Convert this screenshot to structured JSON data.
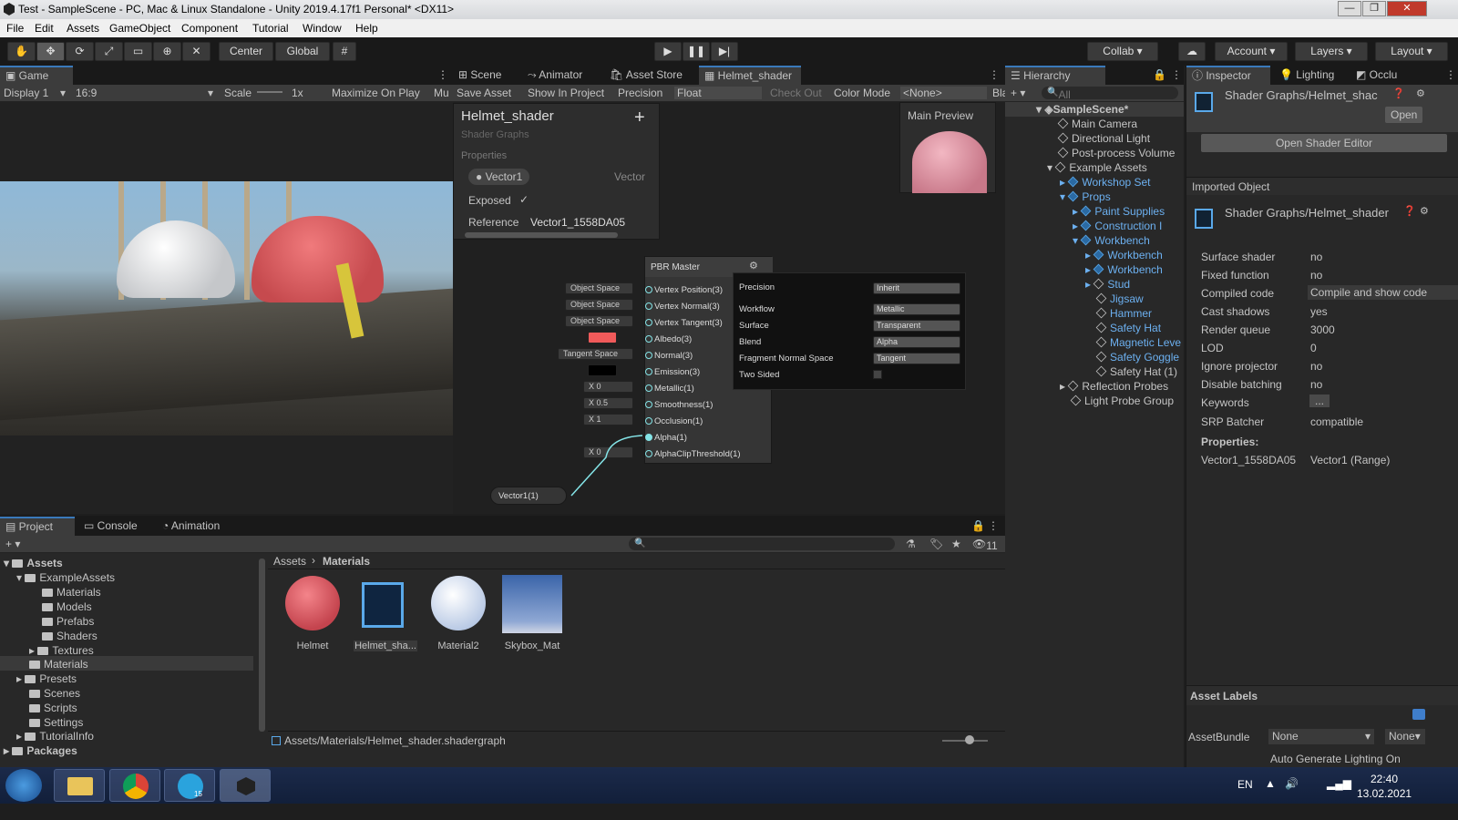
{
  "window": {
    "title": "Test - SampleScene - PC, Mac & Linux Standalone - Unity 2019.4.17f1 Personal* <DX11>"
  },
  "menu": [
    "File",
    "Edit",
    "Assets",
    "GameObject",
    "Component",
    "Tutorial",
    "Window",
    "Help"
  ],
  "toolbar": {
    "center": "Center",
    "global": "Global",
    "collab": "Collab",
    "account": "Account",
    "layers": "Layers",
    "layout": "Layout"
  },
  "game": {
    "tab": "Game",
    "display": "Display 1",
    "aspect": "16:9",
    "scale_label": "Scale",
    "scale_value": "1x",
    "maximize": "Maximize On Play",
    "mute": "Mu"
  },
  "center_tabs": [
    "Scene",
    "Animator",
    "Asset Store",
    "Helmet_shader"
  ],
  "sg_toolbar": {
    "save": "Save Asset",
    "show": "Show In Project",
    "precision_label": "Precision",
    "precision": "Float",
    "checkout": "Check Out",
    "colormode_label": "Color Mode",
    "colormode": "<None>",
    "bl": "Bla"
  },
  "blackboard": {
    "title": "Helmet_shader",
    "subtitle": "Shader Graphs",
    "section": "Properties",
    "prop_name": "Vector1",
    "prop_type": "Vector",
    "exposed_label": "Exposed",
    "reference_label": "Reference",
    "reference_value": "Vector1_1558DA05"
  },
  "main_preview": {
    "title": "Main Preview"
  },
  "pbr": {
    "title": "PBR Master",
    "inputs": [
      {
        "chip": "Object Space",
        "label": "Vertex Position(3)"
      },
      {
        "chip": "Object Space",
        "label": "Vertex Normal(3)"
      },
      {
        "chip": "Object Space",
        "label": "Vertex Tangent(3)"
      },
      {
        "chip": "",
        "label": "Albedo(3)"
      },
      {
        "chip": "Tangent Space",
        "label": "Normal(3)"
      },
      {
        "chip": "",
        "label": "Emission(3)"
      },
      {
        "chip": "X  0",
        "label": "Metallic(1)"
      },
      {
        "chip": "X  0.5",
        "label": "Smoothness(1)"
      },
      {
        "chip": "X  1",
        "label": "Occlusion(1)"
      },
      {
        "chip": "",
        "label": "Alpha(1)"
      },
      {
        "chip": "X  0",
        "label": "AlphaClipThreshold(1)"
      }
    ],
    "settings": [
      {
        "label": "Precision",
        "value": "Inherit"
      },
      {
        "label": "Workflow",
        "value": "Metallic"
      },
      {
        "label": "Surface",
        "value": "Transparent"
      },
      {
        "label": "Blend",
        "value": "Alpha"
      },
      {
        "label": "Fragment Normal Space",
        "value": "Tangent"
      },
      {
        "label": "Two Sided",
        "value": ""
      }
    ],
    "vector_node": "Vector1(1)"
  },
  "hierarchy": {
    "tab": "Hierarchy",
    "search": "All",
    "items": [
      "SampleScene*",
      "Main Camera",
      "Directional Light",
      "Post-process Volume",
      "Example Assets",
      "Workshop Set",
      "Props",
      "Paint Supplies",
      "Construction I",
      "Workbench",
      "Workbench",
      "Workbench",
      "Stud",
      "Jigsaw",
      "Hammer",
      "Safety Hat",
      "Magnetic Leve",
      "Safety Goggle",
      "Safety Hat (1)",
      "Reflection Probes",
      "Light Probe Group"
    ]
  },
  "inspector": {
    "tabs": [
      "Inspector",
      "Lighting",
      "Occlu"
    ],
    "header": "Shader Graphs/Helmet_shac",
    "open": "Open",
    "open_editor": "Open Shader Editor",
    "imported": "Imported Object",
    "imported_title": "Shader Graphs/Helmet_shader",
    "rows": [
      {
        "k": "Surface shader",
        "v": "no"
      },
      {
        "k": "Fixed function",
        "v": "no"
      },
      {
        "k": "Compiled code",
        "v": "Compile and show code"
      },
      {
        "k": "Cast shadows",
        "v": "yes"
      },
      {
        "k": "Render queue",
        "v": "3000"
      },
      {
        "k": "LOD",
        "v": "0"
      },
      {
        "k": "Ignore projector",
        "v": "no"
      },
      {
        "k": "Disable batching",
        "v": "no"
      },
      {
        "k": "Keywords",
        "v": "..."
      },
      {
        "k": "SRP Batcher",
        "v": "compatible"
      }
    ],
    "props_label": "Properties:",
    "prop_k": "Vector1_1558DA05",
    "prop_v": "Vector1 (Range)",
    "asset_labels": "Asset Labels",
    "assetbundle": "AssetBundle",
    "ab_value": "None",
    "ab_variant": "None"
  },
  "project": {
    "tabs": [
      "Project",
      "Console",
      "Animation"
    ],
    "tree": [
      "Assets",
      "ExampleAssets",
      "Materials",
      "Models",
      "Prefabs",
      "Shaders",
      "Textures",
      "Materials",
      "Presets",
      "Scenes",
      "Scripts",
      "Settings",
      "TutorialInfo",
      "Packages"
    ],
    "breadcrumb": [
      "Assets",
      "Materials"
    ],
    "hidden_count": "11",
    "assets": [
      {
        "name": "Helmet"
      },
      {
        "name": "Helmet_sha..."
      },
      {
        "name": "Material2"
      },
      {
        "name": "Skybox_Mat"
      }
    ],
    "path": "Assets/Materials/Helmet_shader.shadergraph"
  },
  "status": {
    "text": "Auto Generate Lighting On"
  },
  "taskbar": {
    "lang": "EN",
    "time": "22:40",
    "date": "13.02.2021",
    "badge": "15"
  }
}
